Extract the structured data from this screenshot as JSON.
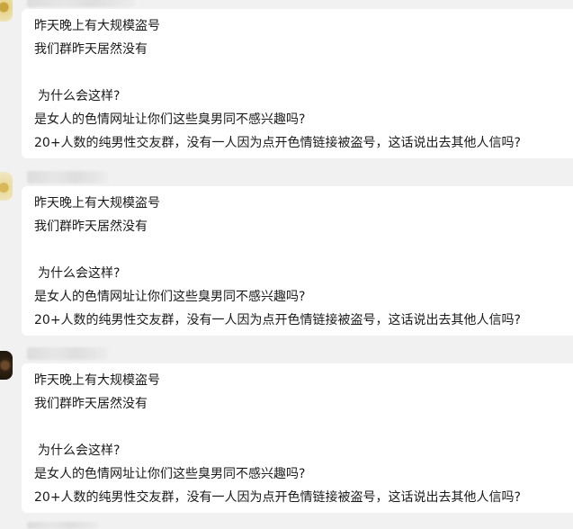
{
  "messages": [
    {
      "lines": [
        "昨天晚上有大规模盗号",
        "我们群昨天居然没有",
        "",
        "为什么会这样?",
        "是女人的色情网址让你们这些臭男同不感兴趣吗?",
        "20+人数的纯男性交友群，没有一人因为点开色情链接被盗号，这话说出去其他人信吗?"
      ]
    },
    {
      "lines": [
        "昨天晚上有大规模盗号",
        "我们群昨天居然没有",
        "",
        "为什么会这样?",
        "是女人的色情网址让你们这些臭男同不感兴趣吗?",
        "20+人数的纯男性交友群，没有一人因为点开色情链接被盗号，这话说出去其他人信吗?"
      ]
    },
    {
      "lines": [
        "昨天晚上有大规模盗号",
        "我们群昨天居然没有",
        "",
        "为什么会这样?",
        "是女人的色情网址让你们这些臭男同不感兴趣吗?",
        "20+人数的纯男性交友群，没有一人因为点开色情链接被盗号，这话说出去其他人信吗?"
      ]
    }
  ]
}
